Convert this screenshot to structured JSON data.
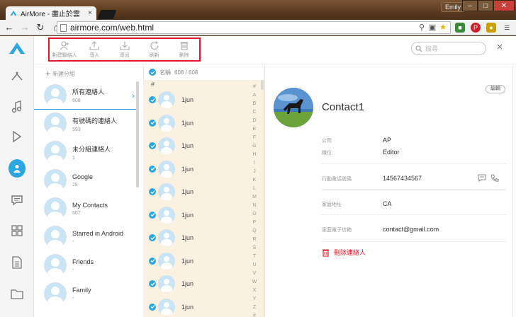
{
  "browser": {
    "tab_title": "AirMore - 盡止於雲",
    "tab_close": "×",
    "user": "Emily",
    "url": "airmore.com/web.html",
    "win_minimize": "–",
    "win_maximize": "□",
    "win_close": "✕"
  },
  "toolbar": {
    "actions": [
      {
        "label": "新建聯絡人",
        "icon": "add-contact-icon"
      },
      {
        "label": "導入",
        "icon": "upload-icon"
      },
      {
        "label": "導出",
        "icon": "download-icon"
      },
      {
        "label": "刷新",
        "icon": "refresh-icon"
      },
      {
        "label": "刪除",
        "icon": "trash-icon"
      }
    ],
    "search_placeholder": "搜尋",
    "close": "×"
  },
  "sidebar": {
    "items": [
      {
        "name": "sidebar-item-apps",
        "icon": "apps-icon"
      },
      {
        "name": "sidebar-item-music",
        "icon": "music-icon"
      },
      {
        "name": "sidebar-item-videos",
        "icon": "play-icon"
      },
      {
        "name": "sidebar-item-contacts",
        "icon": "contact-icon",
        "active": true
      },
      {
        "name": "sidebar-item-messages",
        "icon": "message-icon"
      },
      {
        "name": "sidebar-item-files",
        "icon": "grid-icon"
      },
      {
        "name": "sidebar-item-documents",
        "icon": "document-icon"
      },
      {
        "name": "sidebar-item-folders",
        "icon": "folder-icon"
      }
    ]
  },
  "groups": {
    "new_group": "新建分組",
    "items": [
      {
        "name": "所有連絡人",
        "count": "608",
        "active": true
      },
      {
        "name": "有號碼的連絡人",
        "count": "593"
      },
      {
        "name": "未分組連絡人",
        "count": "1"
      },
      {
        "name": "Google",
        "count": "28"
      },
      {
        "name": "My Contacts",
        "count": "607"
      },
      {
        "name": "Starred in Android",
        "count": "-"
      },
      {
        "name": "Friends",
        "count": "-"
      },
      {
        "name": "Family",
        "count": "-"
      }
    ]
  },
  "contacts": {
    "name_label": "名稱",
    "count": "608 / 608",
    "section": "#",
    "rows": [
      "1jun",
      "1jun",
      "1jun",
      "1jun",
      "1jun",
      "1jun",
      "1jun",
      "1jun",
      "1jun",
      "1jun"
    ],
    "alphabet": [
      "#",
      "A",
      "B",
      "C",
      "D",
      "E",
      "F",
      "G",
      "H",
      "I",
      "J",
      "K",
      "L",
      "M",
      "N",
      "O",
      "P",
      "Q",
      "R",
      "S",
      "T",
      "U",
      "V",
      "W",
      "X",
      "Y",
      "Z",
      "#"
    ]
  },
  "detail": {
    "edit": "編輯",
    "name": "Contact1",
    "company_label": "公司",
    "company": "AP",
    "title_label": "職位",
    "title": "Editor",
    "phone_label": "行動電話號碼",
    "phone": "14567434567",
    "address_label": "家庭地址",
    "address": "CA",
    "email_label": "家庭電子信箱",
    "email": "contact@gmail.com",
    "delete": "刪除連絡人"
  },
  "colors": {
    "accent": "#2aa6e1",
    "danger": "#e0192a",
    "list_bg": "#fbf1e1"
  }
}
